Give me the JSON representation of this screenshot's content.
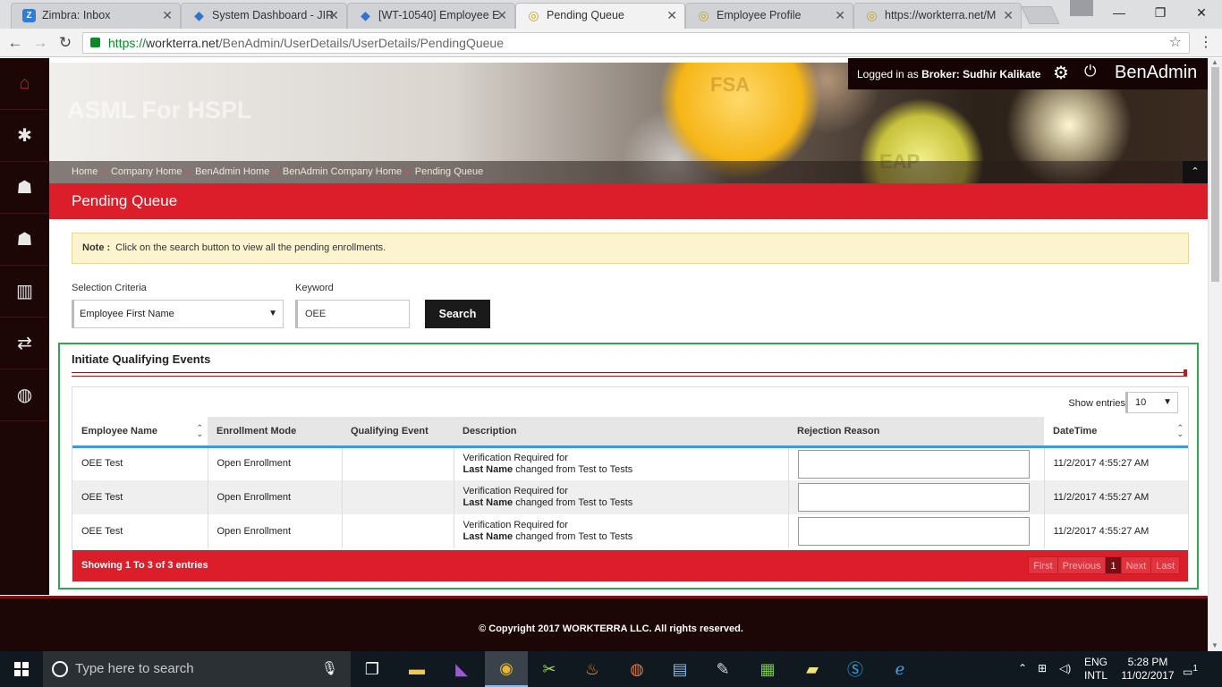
{
  "browser": {
    "tabs": [
      {
        "title": "Zimbra: Inbox",
        "icon": "Z",
        "icon_color": "#2f7bd6"
      },
      {
        "title": "System Dashboard - JIR",
        "icon": "◆",
        "icon_color": "#2f74d0"
      },
      {
        "title": "[WT-10540] Employee E",
        "icon": "◆",
        "icon_color": "#2f74d0"
      },
      {
        "title": "Pending Queue",
        "icon": "◎",
        "icon_color": "#c9a21a",
        "active": true
      },
      {
        "title": "Employee Profile",
        "icon": "◎",
        "icon_color": "#c9a21a"
      },
      {
        "title": "https://workterra.net/M",
        "icon": "◎",
        "icon_color": "#c9a21a"
      }
    ],
    "url_prefix": "https://",
    "url_host": "workterra.net",
    "url_path": "/BenAdmin/UserDetails/UserDetails/PendingQueue"
  },
  "sidebar": {
    "items": [
      {
        "icon": "home-icon",
        "glyph": "⌂"
      },
      {
        "icon": "puzzle-icon",
        "glyph": "✱"
      },
      {
        "icon": "user-star-icon",
        "glyph": "☗"
      },
      {
        "icon": "user-icon",
        "glyph": "☗"
      },
      {
        "icon": "bar-chart-icon",
        "glyph": "▥"
      },
      {
        "icon": "transfer-icon",
        "glyph": "⇄"
      },
      {
        "icon": "chat-icon",
        "glyph": "◍"
      }
    ]
  },
  "header": {
    "client_name": "ASML For HSPL",
    "banner_fsa": "FSA",
    "banner_eap": "EAP",
    "login_prefix": "Logged in as ",
    "login_role": "Broker:",
    "login_user": "Sudhir Kalikate",
    "brand": "BenAdmin",
    "breadcrumb": [
      "Home",
      "Company Home",
      "BenAdmin Home",
      "BenAdmin Company Home",
      "Pending Queue"
    ],
    "breadcrumb_sep": "»"
  },
  "page_title": "Pending Queue",
  "note": {
    "label": "Note :",
    "text": "Click on the search button to view all the pending enrollments."
  },
  "filters": {
    "criteria_label": "Selection Criteria",
    "criteria_value": "Employee First Name",
    "keyword_label": "Keyword",
    "keyword_value": "OEE",
    "search_label": "Search"
  },
  "qualifying_events": {
    "title": "Initiate Qualifying Events",
    "show_entries_label": "Show entries",
    "show_entries_value": "10",
    "columns": [
      "Employee Name",
      "Enrollment Mode",
      "Qualifying Event",
      "Description",
      "Rejection Reason",
      "DateTime"
    ],
    "rows": [
      {
        "name": "OEE Test",
        "mode": "Open Enrollment",
        "event": "",
        "desc_line1": "Verification Required for",
        "desc_field": "Last Name",
        "desc_rest": " changed from Test to Tests",
        "datetime": "11/2/2017 4:55:27 AM"
      },
      {
        "name": "OEE Test",
        "mode": "Open Enrollment",
        "event": "",
        "desc_line1": "Verification Required for",
        "desc_field": "Last Name",
        "desc_rest": " changed from Test to Tests",
        "datetime": "11/2/2017 4:55:27 AM"
      },
      {
        "name": "OEE Test",
        "mode": "Open Enrollment",
        "event": "",
        "desc_line1": "Verification Required for",
        "desc_field": "Last Name",
        "desc_rest": " changed from Test to Tests",
        "datetime": "11/2/2017 4:55:27 AM"
      }
    ],
    "showing": "Showing 1 To 3 of 3 entries",
    "pager": {
      "first": "First",
      "previous": "Previous",
      "current": "1",
      "next": "Next",
      "last": "Last"
    }
  },
  "footer": {
    "copyright": "© Copyright 2017 WORKTERRA LLC. All rights reserved."
  },
  "taskbar": {
    "search_placeholder": "Type here to search",
    "lang_top": "ENG",
    "lang_bottom": "INTL",
    "time": "5:28 PM",
    "date": "11/02/2017",
    "notifications": "1"
  },
  "colors": {
    "accent_red": "#dc1e2a",
    "dark_sidebar": "#1c0606",
    "panel_green": "#2fa84f",
    "header_blue": "#3f9bd6"
  }
}
